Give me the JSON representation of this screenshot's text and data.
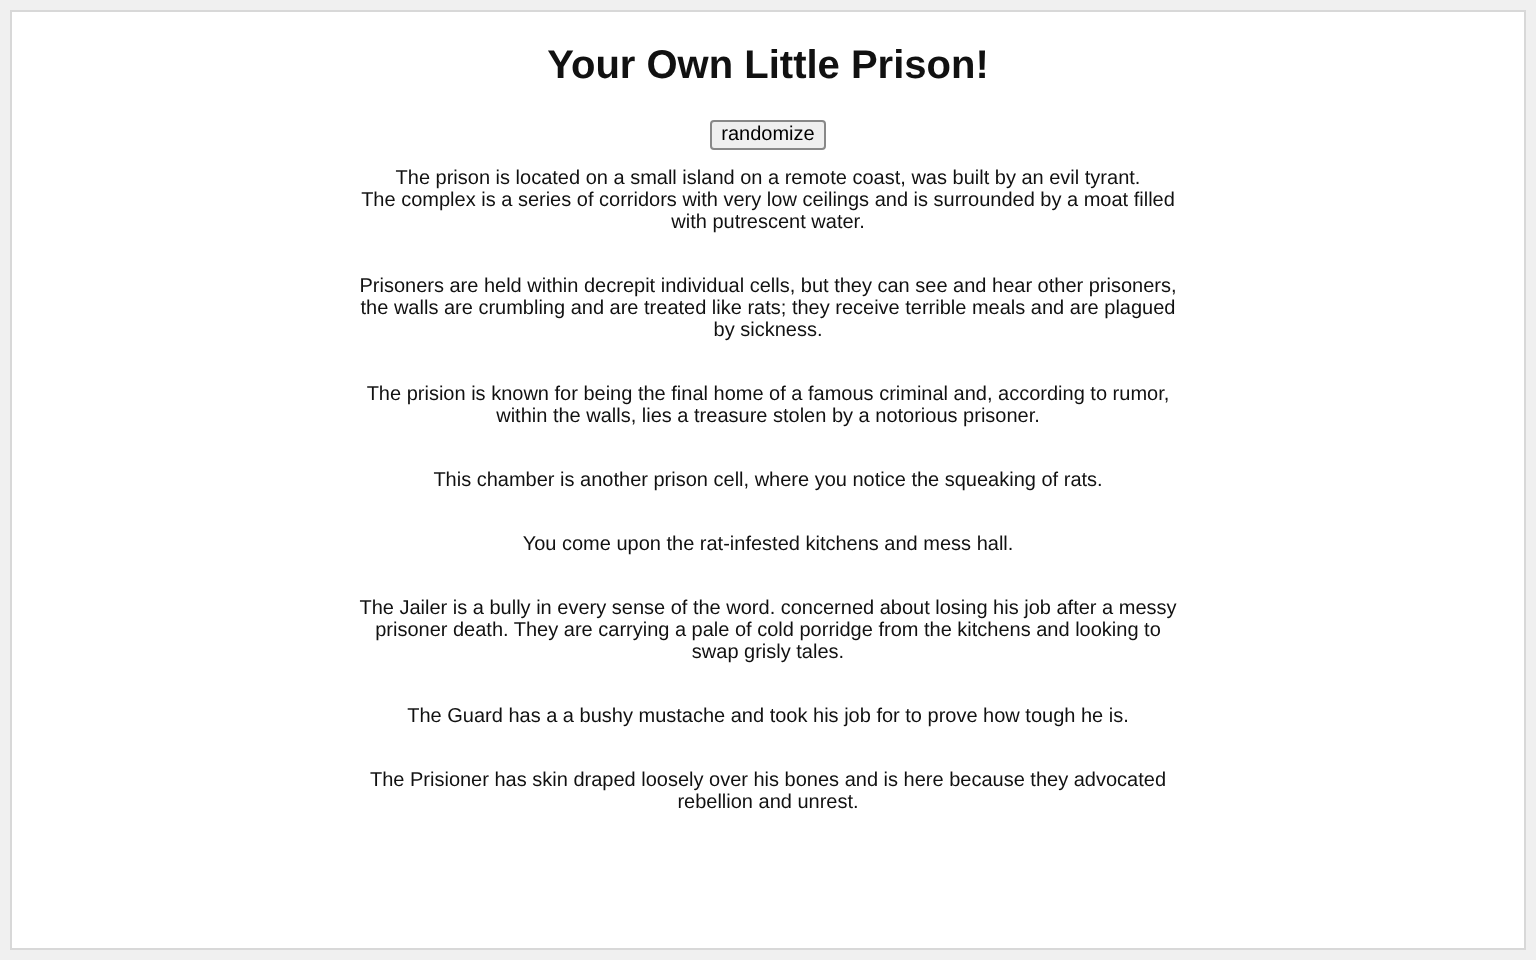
{
  "title": "Your Own Little Prison!",
  "button": "randomize",
  "paragraphs": [
    {
      "sentences": [
        "The prison is located on a small island on a remote coast, was built by an evil tyrant.",
        "The complex is a series of corridors with very low ceilings and is surrounded by a moat filled with putrescent water."
      ]
    },
    {
      "sentences": [
        "Prisoners are held within decrepit individual cells, but they can see and hear other prisoners, the walls are crumbling and are treated like rats; they receive terrible meals and are plagued by sickness."
      ]
    },
    {
      "sentences": [
        "The prision is known for being the final home of a famous criminal and, according to rumor, within the walls, lies a treasure stolen by a notorious prisoner."
      ]
    },
    {
      "sentences": [
        "This chamber is another prison cell, where you notice the squeaking of rats."
      ]
    },
    {
      "sentences": [
        "You come upon the rat-infested kitchens and mess hall."
      ]
    },
    {
      "sentences": [
        "The Jailer is a bully in every sense of the word. concerned about losing his job after a messy prisoner death. They are carrying a pale of cold porridge from the kitchens and looking to swap grisly tales."
      ]
    },
    {
      "sentences": [
        "The Guard has a a bushy mustache and took his job for to prove how tough he is."
      ]
    },
    {
      "sentences": [
        "The Prisioner has skin draped loosely over his bones and is here because they advocated rebellion and unrest."
      ]
    }
  ]
}
